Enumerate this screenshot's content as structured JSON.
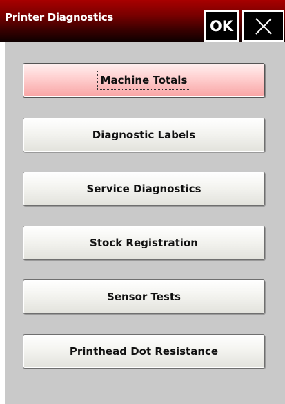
{
  "dialog": {
    "title": "Printer Diagnostics",
    "ok_label": "OK",
    "close_icon": "close-icon"
  },
  "menu": {
    "items": [
      {
        "label": "Machine Totals",
        "selected": true
      },
      {
        "label": "Diagnostic Labels",
        "selected": false
      },
      {
        "label": "Service Diagnostics",
        "selected": false
      },
      {
        "label": "Stock Registration",
        "selected": false
      },
      {
        "label": "Sensor Tests",
        "selected": false
      },
      {
        "label": "Printhead Dot Resistance",
        "selected": false
      }
    ]
  },
  "colors": {
    "titlebar_top": "#a80000",
    "titlebar_bottom": "#0e0000",
    "content_background": "#c9c9c9",
    "selected_button": "#ffd2d2"
  }
}
